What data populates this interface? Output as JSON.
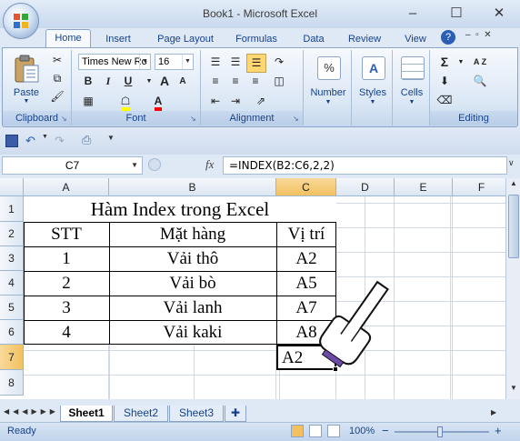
{
  "window": {
    "title": "Book1 - Microsoft Excel"
  },
  "tabs": [
    "Home",
    "Insert",
    "Page Layout",
    "Formulas",
    "Data",
    "Review",
    "View"
  ],
  "ribbon": {
    "clipboard": {
      "label": "Clipboard",
      "paste": "Paste"
    },
    "font": {
      "label": "Font",
      "name": "Times New Ro",
      "size": "16",
      "bold": "B",
      "italic": "I",
      "underline": "U",
      "grow": "A",
      "shrink": "A",
      "font_color_glyph": "A"
    },
    "alignment": {
      "label": "Alignment"
    },
    "number": {
      "label": "Number",
      "glyph": "%"
    },
    "styles": {
      "label": "Styles"
    },
    "cells": {
      "label": "Cells"
    },
    "editing": {
      "label": "Editing",
      "sum": "Σ",
      "sort": "A Z"
    }
  },
  "formula_bar": {
    "name_box": "C7",
    "fx": "fx",
    "formula": "=INDEX(B2:C6,2,2)"
  },
  "columns": [
    "A",
    "B",
    "C",
    "D",
    "E",
    "F"
  ],
  "rows": [
    "1",
    "2",
    "3",
    "4",
    "5",
    "6",
    "7",
    "8"
  ],
  "cells": {
    "title": "Hàm Index trong Excel",
    "headers": [
      "STT",
      "Mặt hàng",
      "Vị trí"
    ],
    "data": [
      [
        "1",
        "Vải thô",
        "A2"
      ],
      [
        "2",
        "Vải bò",
        "A5"
      ],
      [
        "3",
        "Vải lanh",
        "A7"
      ],
      [
        "4",
        "Vải kaki",
        "A8"
      ]
    ],
    "result": "A2"
  },
  "sheets": [
    "Sheet1",
    "Sheet2",
    "Sheet3"
  ],
  "status": {
    "ready": "Ready",
    "zoom": "100%",
    "zoom_minus": "−",
    "zoom_plus": "+"
  },
  "colors": {
    "accent": "#15428b",
    "selected_header": "#f1c15f"
  }
}
